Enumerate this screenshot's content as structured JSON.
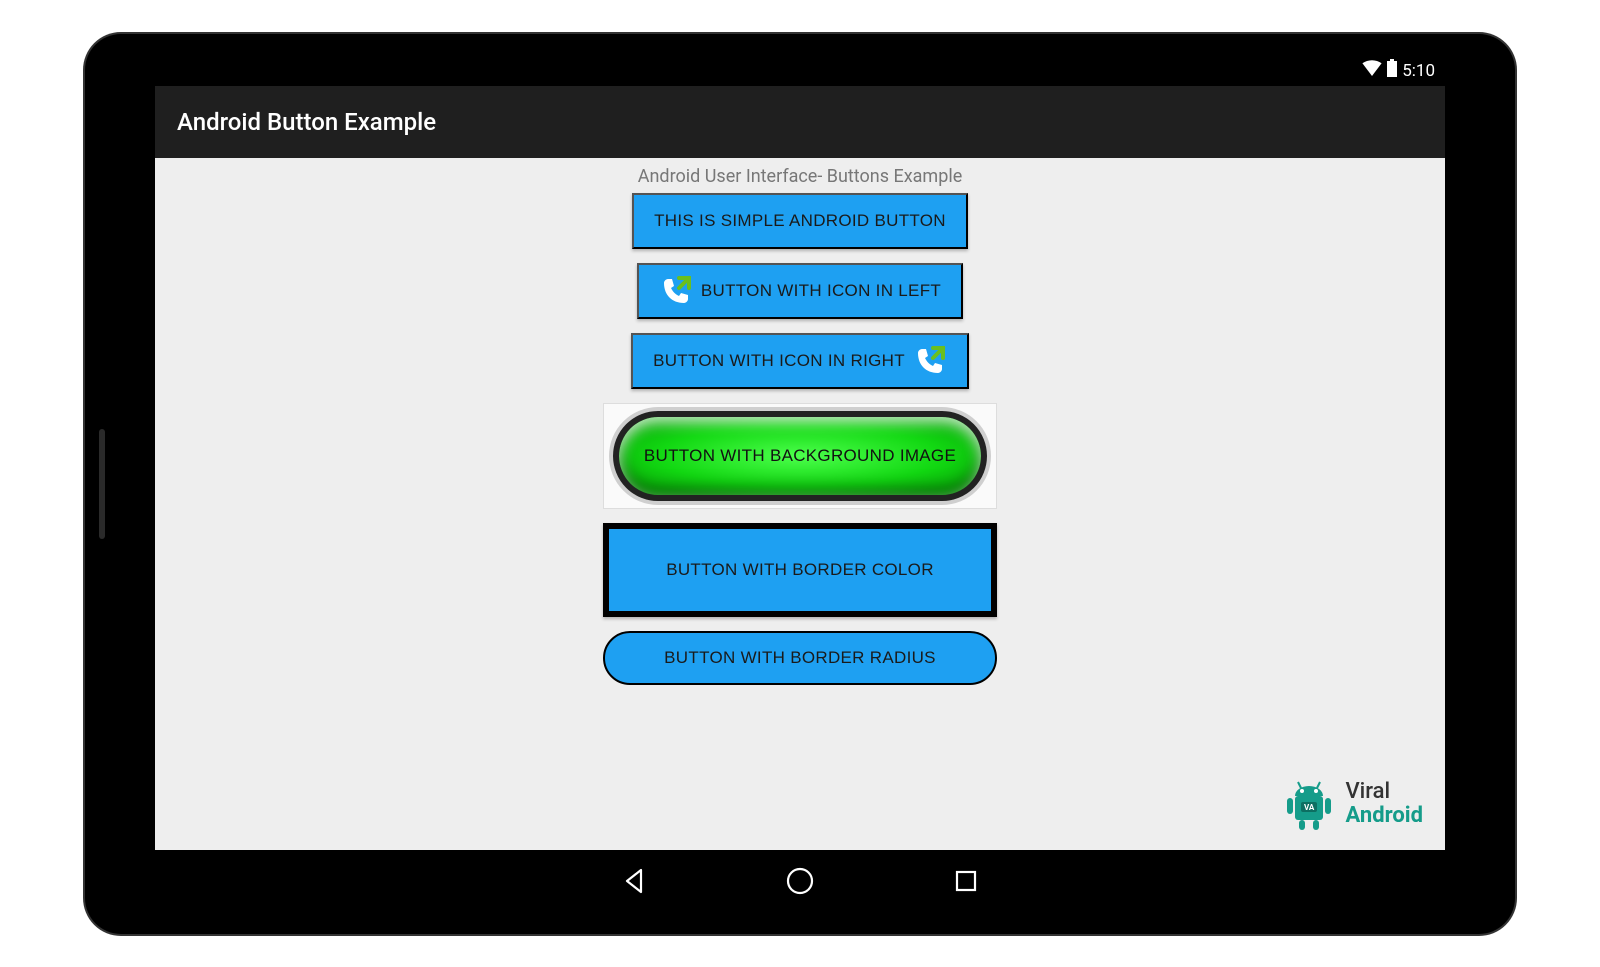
{
  "status_bar": {
    "time": "5:10"
  },
  "action_bar": {
    "title": "Android Button Example"
  },
  "content": {
    "subtitle": "Android User Interface- Buttons Example",
    "buttons": {
      "simple": "THIS IS SIMPLE ANDROID BUTTON",
      "icon_left": "BUTTON WITH ICON IN LEFT",
      "icon_right": "BUTTON WITH ICON IN RIGHT",
      "bg_image": "BUTTON WITH BACKGROUND IMAGE",
      "border_color": "BUTTON WITH BORDER COLOR",
      "border_radius": "BUTTON WITH BORDER RADIUS"
    }
  },
  "watermark": {
    "line1": "Viral",
    "line2": "Android"
  }
}
